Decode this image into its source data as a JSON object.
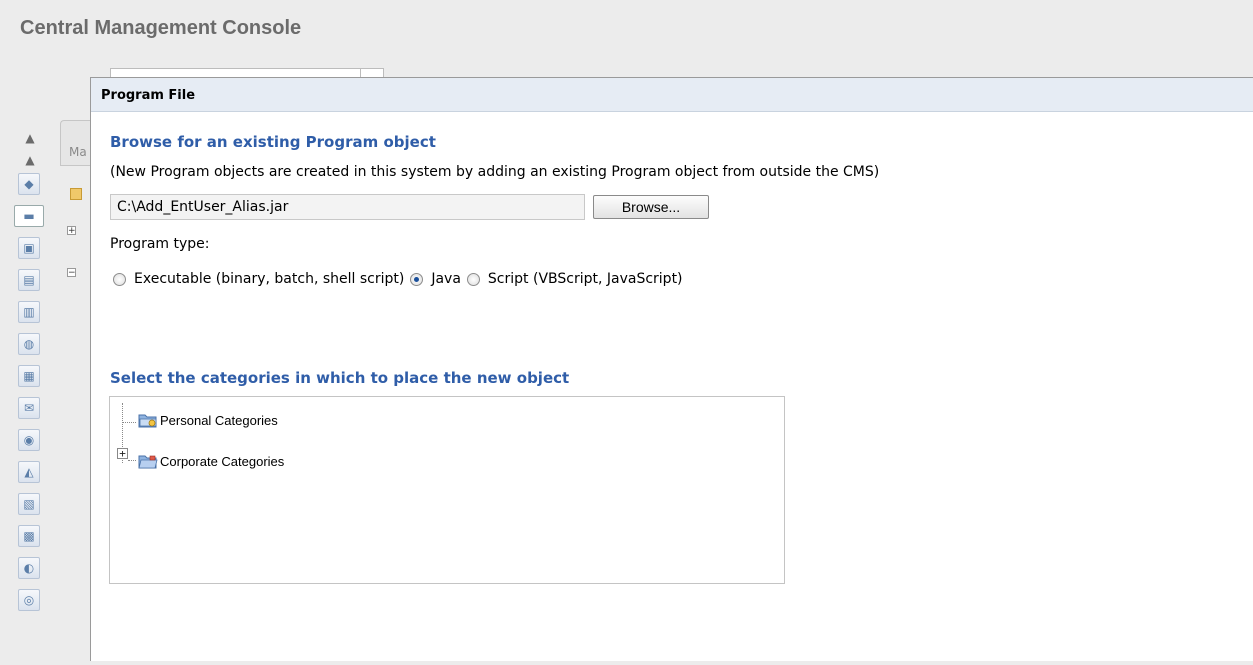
{
  "app": {
    "title": "Central Management Console"
  },
  "background": {
    "tab_stub_label": "Ma"
  },
  "dialog": {
    "title": "Program File",
    "browse_heading": "Browse for an existing Program object",
    "helper_text": "(New Program objects are created in this system by adding an existing Program object from outside the CMS)",
    "file_path_value": "C:\\Add_EntUser_Alias.jar",
    "browse_button_label": "Browse...",
    "program_type_label": "Program type:",
    "program_types": [
      {
        "label": "Executable (binary, batch, shell script)",
        "checked": false
      },
      {
        "label": "Java",
        "checked": true
      },
      {
        "label": "Script (VBScript, JavaScript)",
        "checked": false
      }
    ],
    "categories_heading": "Select the categories in which to place the new object",
    "categories": [
      {
        "label": "Personal Categories",
        "icon": "personal-categories-icon",
        "expandable": false
      },
      {
        "label": "Corporate Categories",
        "icon": "corporate-categories-icon",
        "expandable": true,
        "expander_symbol": "+"
      }
    ]
  },
  "colors": {
    "heading_blue": "#2f5da8",
    "title_grey": "#6b6b6b",
    "dialog_header": "#e6ecf4"
  }
}
